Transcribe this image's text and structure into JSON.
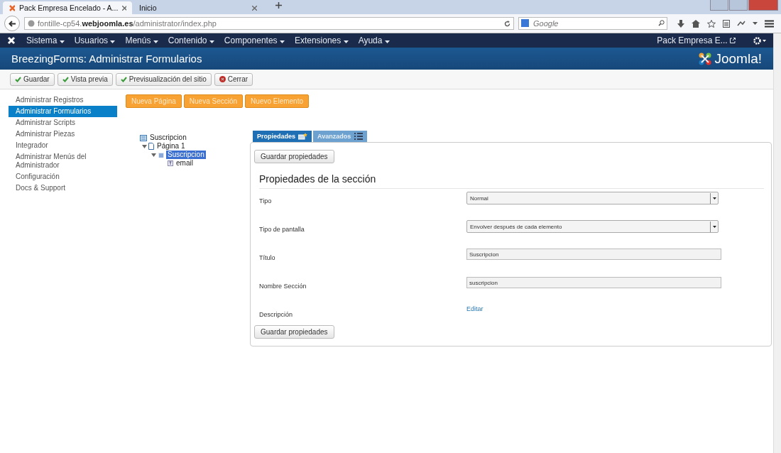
{
  "browser": {
    "tabs": [
      {
        "title": "Pack Empresa Encelado - A...",
        "selected": true
      },
      {
        "title": "Inicio",
        "selected": false
      }
    ],
    "address": "fontille-cp54.**webjoomla.es**/administrator/index.php",
    "search": {
      "placeholder": "Google"
    }
  },
  "navbar": {
    "menus": [
      "Sistema",
      "Usuarios",
      "Menús",
      "Contenido",
      "Componentes",
      "Extensiones",
      "Ayuda"
    ],
    "site": "Pack Empresa E..."
  },
  "header": {
    "title": "BreezingForms: Administrar Formularios",
    "logo": "Joomla!"
  },
  "toolbar": [
    {
      "label": "Guardar",
      "kind": "check"
    },
    {
      "label": "Vista previa",
      "kind": "check"
    },
    {
      "label": "Previsualización del sitio",
      "kind": "check"
    },
    {
      "label": "Cerrar",
      "kind": "close"
    }
  ],
  "sidebar": {
    "items": [
      {
        "label": "Administrar Registros",
        "selected": false
      },
      {
        "label": "Administrar Formularios",
        "selected": true
      },
      {
        "label": "Administrar Scripts",
        "selected": false
      },
      {
        "label": "Administrar Piezas",
        "selected": false
      },
      {
        "label": "Integrador",
        "selected": false
      },
      {
        "label": "Administrar Menús del Administrador",
        "selected": false
      },
      {
        "label": "Configuración",
        "selected": false
      },
      {
        "label": "Docs & Support",
        "selected": false
      }
    ]
  },
  "actions": [
    "Nueva Página",
    "Nueva Sección",
    "Nuevo Elemento"
  ],
  "tree": [
    {
      "label": "Suscripcion",
      "kind": "form",
      "selected": false,
      "children": [
        {
          "label": "Página 1",
          "kind": "page",
          "selected": false,
          "expanded": true,
          "children": [
            {
              "label": "Suscripcion",
              "kind": "section",
              "selected": true,
              "expanded": true,
              "children": [
                {
                  "label": "email",
                  "kind": "element",
                  "selected": false
                }
              ]
            }
          ]
        }
      ]
    }
  ],
  "tabs": [
    {
      "label": "Propiedades",
      "selected": true
    },
    {
      "label": "Avanzados",
      "selected": false
    }
  ],
  "form": {
    "save_top": "Guardar propiedades",
    "heading": "Propiedades de la sección",
    "fields": [
      {
        "label": "Tipo",
        "kind": "select",
        "value": "Normal"
      },
      {
        "label": "Tipo de pantalla",
        "kind": "select",
        "value": "Envolver después de cada elemento"
      },
      {
        "label": "Título",
        "kind": "text",
        "value": "Suscripcion"
      },
      {
        "label": "Nombre Sección",
        "kind": "text",
        "value": "suscripcion"
      },
      {
        "label": "Descripción",
        "kind": "link",
        "value": "Editar"
      }
    ],
    "save_bottom": "Guardar propiedades"
  }
}
